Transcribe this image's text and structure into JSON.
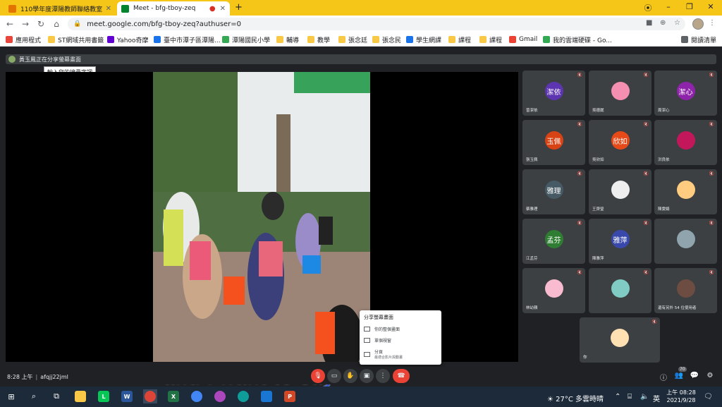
{
  "browser": {
    "tabs": [
      {
        "label": "110學年度潭陽教師聯絡教室",
        "active": false,
        "favicon_color": "#e37400"
      },
      {
        "label": "Meet - bfg-tboy-zeq",
        "active": true,
        "favicon_color": "#00832d"
      }
    ],
    "new_tab_label": "+",
    "url": "meet.google.com/bfg-tboy-zeq?authuser=0",
    "bookmarks": [
      {
        "label": "應用程式",
        "color": "#e8453c"
      },
      {
        "label": "ST網域共用書籤",
        "color": "#f9c846"
      },
      {
        "label": "Yahoo奇摩",
        "color": "#6001d2"
      },
      {
        "label": "臺中市潭子區潭陽...",
        "color": "#1a73e8"
      },
      {
        "label": "潭陽國民小學",
        "color": "#34a853"
      },
      {
        "label": "輔導",
        "color": "#f9c846"
      },
      {
        "label": "教學",
        "color": "#f9c846"
      },
      {
        "label": "張念廷",
        "color": "#f9c846"
      },
      {
        "label": "張念民",
        "color": "#f9c846"
      },
      {
        "label": "學生網課",
        "color": "#1a73e8"
      },
      {
        "label": "課程",
        "color": "#f9c846"
      },
      {
        "label": "課程",
        "color": "#f9c846"
      },
      {
        "label": "Gmail",
        "color": "#ea4335"
      },
      {
        "label": "我的雲端硬碟 - Go...",
        "color": "#34a853"
      },
      {
        "label": "閱讀清單",
        "color": "#5f6368"
      }
    ]
  },
  "meet": {
    "presenting_banner": "黃玉鳳正在分享螢幕畫面",
    "tooltip": "輸入您的搜尋字詞",
    "caption": "and I want to say",
    "share_menu": {
      "title": "分享螢幕畫面",
      "items": [
        {
          "label": "你的整個畫面"
        },
        {
          "label": "單個視窗"
        },
        {
          "label": "分頁",
          "sub": "最適合影片與動畫"
        }
      ]
    },
    "participants": [
      {
        "initials": "潔依",
        "name": "曾潔依",
        "color": "#5e35b1"
      },
      {
        "initials": "",
        "name": "吳德崴",
        "color": "#f48fb1"
      },
      {
        "initials": "潔心",
        "name": "周潔心",
        "color": "#8e24aa"
      },
      {
        "initials": "玉佩",
        "name": "張玉佩",
        "color": "#d84315"
      },
      {
        "initials": "欣如",
        "name": "吳欣如",
        "color": "#e64a19"
      },
      {
        "initials": "",
        "name": "洪良依",
        "color": "#c2185b"
      },
      {
        "initials": "雅理",
        "name": "蔡雅理",
        "color": "#455a64"
      },
      {
        "initials": "",
        "name": "王齊瑩",
        "color": "#eeeeee"
      },
      {
        "initials": "",
        "name": "陳雯娟",
        "color": "#ffcc80"
      },
      {
        "initials": "孟芬",
        "name": "江孟芬",
        "color": "#2e7d32"
      },
      {
        "initials": "雅萍",
        "name": "陳雅萍",
        "color": "#3949ab"
      },
      {
        "initials": "",
        "name": "",
        "color": "#90a4ae"
      },
      {
        "initials": "",
        "name": "林幼蘋",
        "color": "#f8bbd0"
      },
      {
        "initials": "",
        "name": "",
        "color": "#80cbc4"
      },
      {
        "initials": "",
        "name": "還有另外 54 位使用者",
        "color": "#6d4c41"
      },
      {
        "initials": "",
        "name": "你",
        "color": "#ffe0b2"
      }
    ],
    "clock": "8:28 上午",
    "meeting_code": "afqjj22jml",
    "participant_count": "70"
  },
  "taskbar": {
    "weather": "27°C 多雲時晴",
    "ime": "英",
    "time": "上午 08:28",
    "date": "2021/9/28"
  }
}
